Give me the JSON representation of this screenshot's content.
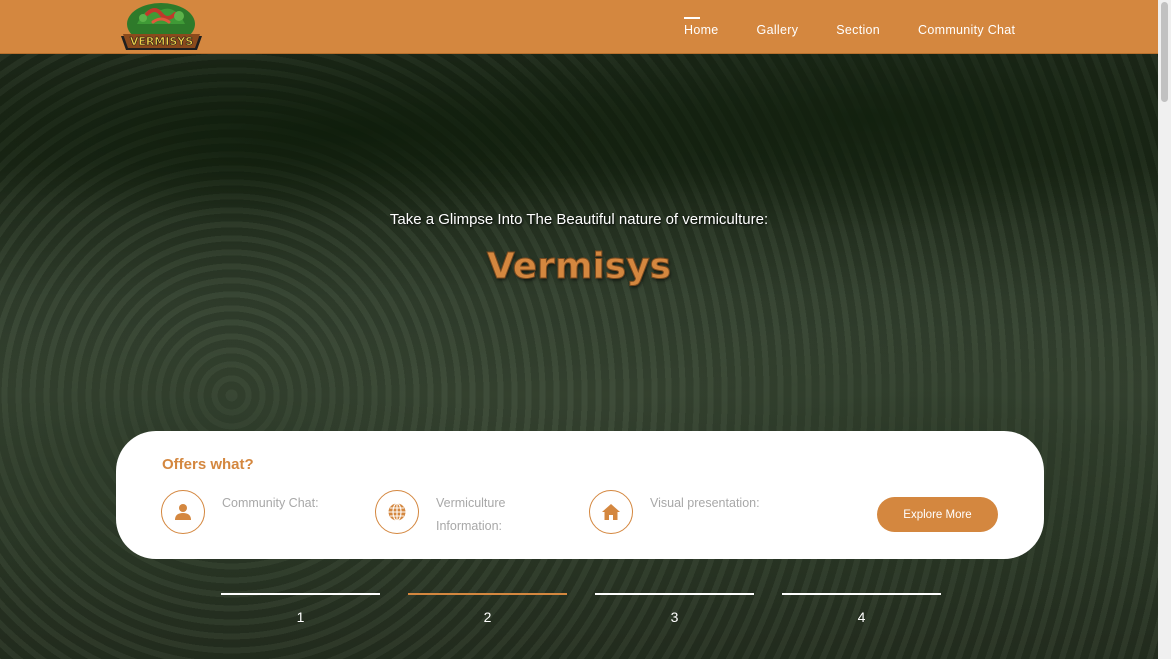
{
  "nav": {
    "logo_text": "VERMISYS",
    "links": [
      {
        "label": "Home",
        "active": true
      },
      {
        "label": "Gallery",
        "active": false
      },
      {
        "label": "Section",
        "active": false
      },
      {
        "label": "Community Chat",
        "active": false
      }
    ]
  },
  "hero": {
    "tagline": "Take a Glimpse Into The Beautiful nature of vermiculture:",
    "title": "Vermisys"
  },
  "offers": {
    "title": "Offers what?",
    "items": [
      {
        "label": "Community Chat:",
        "icon": "user-icon"
      },
      {
        "label": "Vermiculture Information:",
        "icon": "globe-icon"
      },
      {
        "label": "Visual presentation:",
        "icon": "home-icon"
      }
    ],
    "button_label": "Explore More"
  },
  "slider": {
    "indicators": [
      "1",
      "2",
      "3",
      "4"
    ],
    "active_index": 1
  },
  "colors": {
    "brand": "#d4873f",
    "white": "#ffffff"
  }
}
